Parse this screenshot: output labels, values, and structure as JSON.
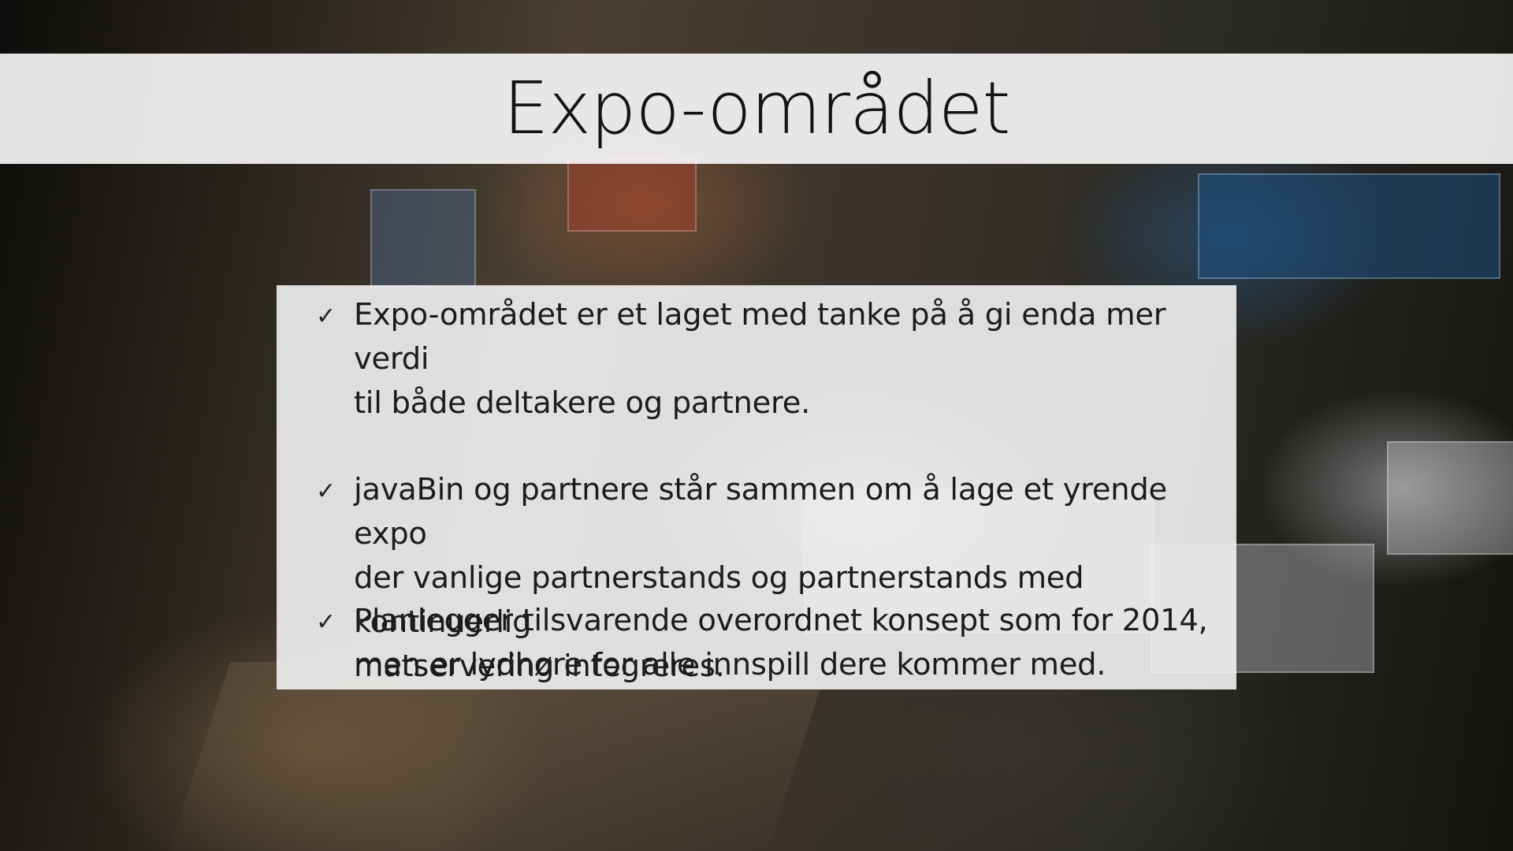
{
  "slide": {
    "title": "Expo-området",
    "bullets": [
      {
        "icon": "checkmark-icon",
        "lines": [
          "Expo-området er et laget med tanke på å gi enda mer verdi",
          "til både deltakere og partnere."
        ]
      },
      {
        "icon": "checkmark-icon",
        "lines": [
          "javaBin og partnere står sammen om å lage et yrende expo",
          "der vanlige partnerstands og partnerstands med kontinuerlig",
          "matservering integreres."
        ]
      },
      {
        "icon": "checkmark-icon",
        "lines": [
          "Planlegger tilsvarende overordnet konsept som for 2014,",
          "men er lydhøre for alle innspill dere kommer med."
        ]
      }
    ],
    "check_glyph": "✓"
  },
  "colors": {
    "title_band": "#f4f4f4",
    "content_box": "#f2f2f2",
    "text": "#1c1c1c"
  }
}
